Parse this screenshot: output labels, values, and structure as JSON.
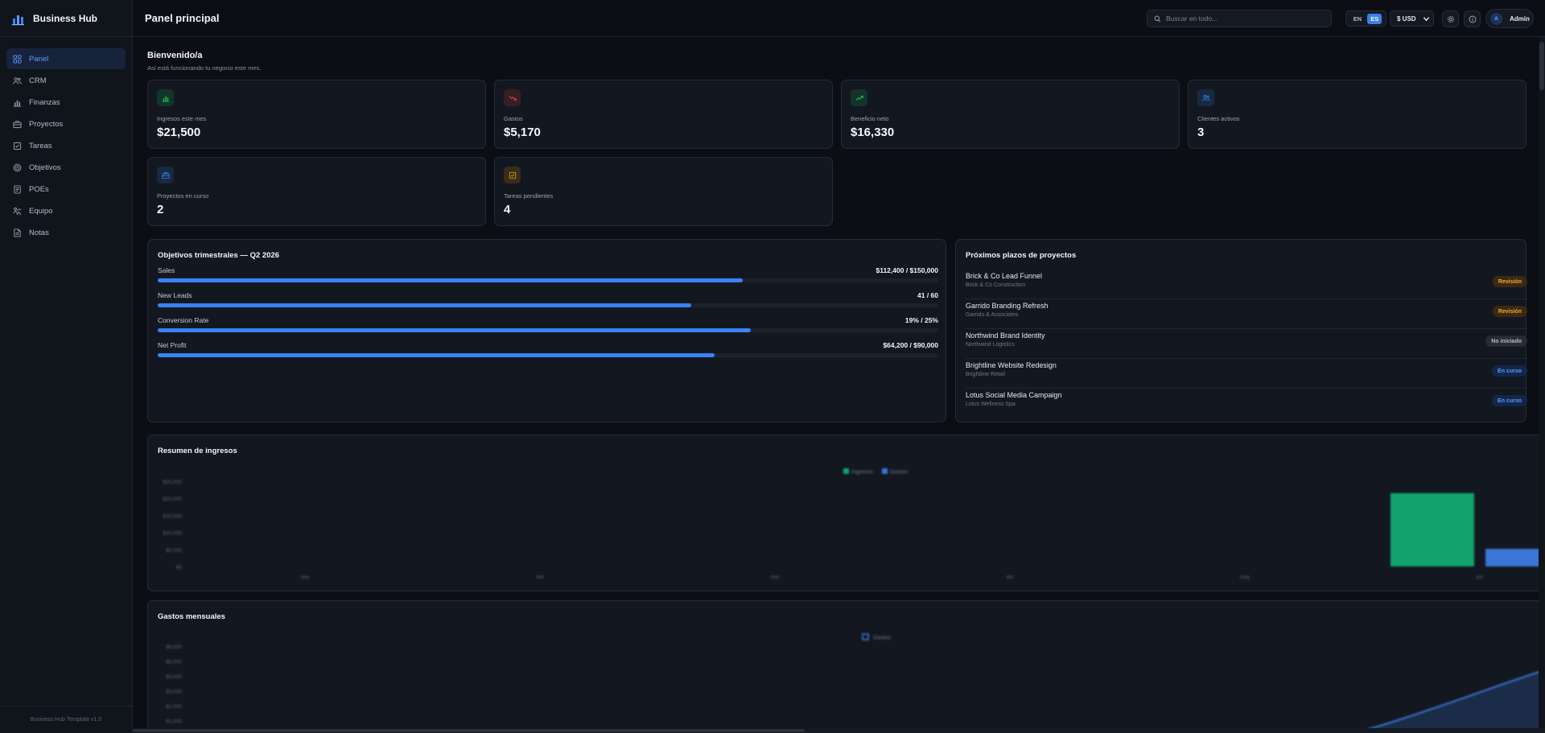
{
  "app": {
    "name": "Business Hub",
    "footer": "Business Hub Template v1.0"
  },
  "sidebar": {
    "items": [
      {
        "label": "Panel",
        "icon": "dashboard-icon",
        "active": true
      },
      {
        "label": "CRM",
        "icon": "users-icon",
        "active": false
      },
      {
        "label": "Finanzas",
        "icon": "bar-chart-icon",
        "active": false
      },
      {
        "label": "Proyectos",
        "icon": "briefcase-icon",
        "active": false
      },
      {
        "label": "Tareas",
        "icon": "checkbox-icon",
        "active": false
      },
      {
        "label": "Objetivos",
        "icon": "target-icon",
        "active": false
      },
      {
        "label": "POEs",
        "icon": "document-list-icon",
        "active": false
      },
      {
        "label": "Equipo",
        "icon": "team-icon",
        "active": false
      },
      {
        "label": "Notas",
        "icon": "note-icon",
        "active": false
      }
    ]
  },
  "topbar": {
    "title": "Panel principal",
    "search_placeholder": "Buscar en todo...",
    "lang_en": "EN",
    "lang_es": "ES",
    "active_lang": "ES",
    "currency": "$ USD",
    "user_initial": "A",
    "user_name": "Admin"
  },
  "welcome": {
    "title": "Bienvenido/a",
    "subtitle": "Así está funcionando tu negocio este mes."
  },
  "stats": [
    {
      "label": "Ingresos este mes",
      "value": "$21,500",
      "icon": "bar-chart-icon",
      "color": "#22c55e"
    },
    {
      "label": "Gastos",
      "value": "$5,170",
      "icon": "trend-down-icon",
      "color": "#ef4444"
    },
    {
      "label": "Beneficio neto",
      "value": "$16,330",
      "icon": "trend-up-icon",
      "color": "#22c55e"
    },
    {
      "label": "Clientes activos",
      "value": "3",
      "icon": "users-icon",
      "color": "#3b82f6"
    },
    {
      "label": "Proyectos en curso",
      "value": "2",
      "icon": "briefcase-icon",
      "color": "#3b82f6"
    },
    {
      "label": "Tareas pendientes",
      "value": "4",
      "icon": "checkbox-icon",
      "color": "#f59e0b"
    }
  ],
  "goals": {
    "title": "Objetivos trimestrales — Q2 2026",
    "items": [
      {
        "name": "Sales",
        "value": "$112,400 / $150,000",
        "progress": 0.749
      },
      {
        "name": "New Leads",
        "value": "41 / 60",
        "progress": 0.683
      },
      {
        "name": "Conversion Rate",
        "value": "19% / 25%",
        "progress": 0.76
      },
      {
        "name": "Net Profit",
        "value": "$64,200 / $90,000",
        "progress": 0.713
      }
    ]
  },
  "deadlines": {
    "title": "Próximos plazos de proyectos",
    "items": [
      {
        "name": "Brick & Co Lead Funnel",
        "client": "Brick & Co Construction",
        "status": "Revisión",
        "kind": "review"
      },
      {
        "name": "Garrido Branding Refresh",
        "client": "Garrido & Associates",
        "status": "Revisión",
        "kind": "review"
      },
      {
        "name": "Northwind Brand Identity",
        "client": "Northwind Logistics",
        "status": "No iniciado",
        "kind": "notstarted"
      },
      {
        "name": "Brightline Website Redesign",
        "client": "Brightline Retail",
        "status": "En curso",
        "kind": "inprogress"
      },
      {
        "name": "Lotus Social Media Campaign",
        "client": "Lotus Wellness Spa",
        "status": "En curso",
        "kind": "inprogress"
      }
    ]
  },
  "chart_data": [
    {
      "type": "bar",
      "title": "Resumen de ingresos",
      "categories": [
        "ene",
        "feb",
        "mar",
        "abr",
        "may",
        "jun"
      ],
      "series": [
        {
          "name": "Ingresos",
          "values": [
            0,
            0,
            0,
            0,
            0,
            21500
          ],
          "color": "#10a36e"
        },
        {
          "name": "Gastos",
          "values": [
            0,
            0,
            0,
            0,
            0,
            5170
          ],
          "color": "#3b75d6"
        }
      ],
      "yticks": [
        "$25,000",
        "$20,000",
        "$15,000",
        "$10,000",
        "$5,000",
        "$0"
      ],
      "ylim": [
        0,
        25000
      ],
      "legend": "top-center",
      "grid": false
    },
    {
      "type": "area",
      "title": "Gastos mensuales",
      "series": [
        {
          "name": "Gastos",
          "color": "#3b75d6"
        }
      ],
      "yticks": [
        "$6,000",
        "$5,000",
        "$4,000",
        "$3,000",
        "$2,000",
        "$1,000"
      ],
      "legend": "top-center",
      "grid": false
    }
  ]
}
